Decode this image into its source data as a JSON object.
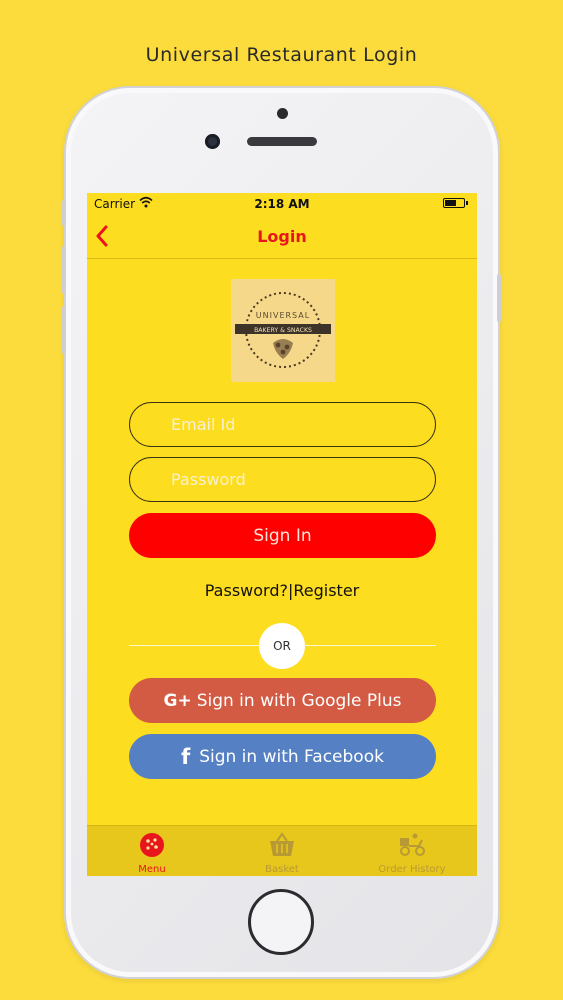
{
  "page_caption": "Universal Restaurant Login",
  "status_bar": {
    "carrier": "Carrier",
    "time": "2:18 AM"
  },
  "nav": {
    "title": "Login"
  },
  "logo": {
    "line1": "UNIVERSAL",
    "line2": "BAKERY & SNACKS"
  },
  "form": {
    "email_placeholder": "Email Id",
    "password_placeholder": "Password",
    "signin_label": "Sign In",
    "forgot_label": "Password?",
    "separator": "|",
    "register_label": "Register",
    "or_label": "OR"
  },
  "social": {
    "google_icon": "G+",
    "google_label": "Sign in with Google Plus",
    "facebook_icon": "f",
    "facebook_label": "Sign in with Facebook"
  },
  "tabs": [
    {
      "label": "Menu",
      "icon": "pizza-icon",
      "active": true
    },
    {
      "label": "Basket",
      "icon": "basket-icon",
      "active": false
    },
    {
      "label": "Order History",
      "icon": "delivery-scooter-icon",
      "active": false
    }
  ],
  "colors": {
    "background": "#fbdc3c",
    "screen": "#fddd1f",
    "accent_red": "#e8161c",
    "signin": "#ff0000",
    "google": "#d35a43",
    "facebook": "#5580c3"
  }
}
